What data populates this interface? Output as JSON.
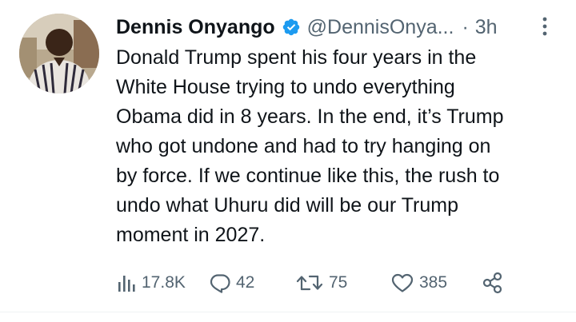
{
  "tweet": {
    "author": {
      "display_name": "Dennis Onyango",
      "handle": "@DennisOnya...",
      "verified": true
    },
    "separator": "·",
    "timestamp": "3h",
    "text": "Donald Trump spent his four years in the\nWhite House trying to undo everything\nObama did in 8 years. In the end, it’s Trump\nwho got undone and had to try hanging on\nby force. If we continue like this, the rush to\nundo what  Uhuru did will be our Trump\nmoment in 2027.",
    "stats": {
      "views": "17.8K",
      "replies": "42",
      "retweets": "75",
      "likes": "385"
    }
  },
  "icons": {
    "verified": "verified-badge-icon",
    "more": "more-options-icon",
    "views": "analytics-icon",
    "reply": "reply-icon",
    "retweet": "retweet-icon",
    "like": "heart-icon",
    "share": "share-icon"
  },
  "colors": {
    "text_primary": "#0f1419",
    "text_secondary": "#536471",
    "verified_blue": "#1d9bf0",
    "divider": "#eff3f4"
  }
}
